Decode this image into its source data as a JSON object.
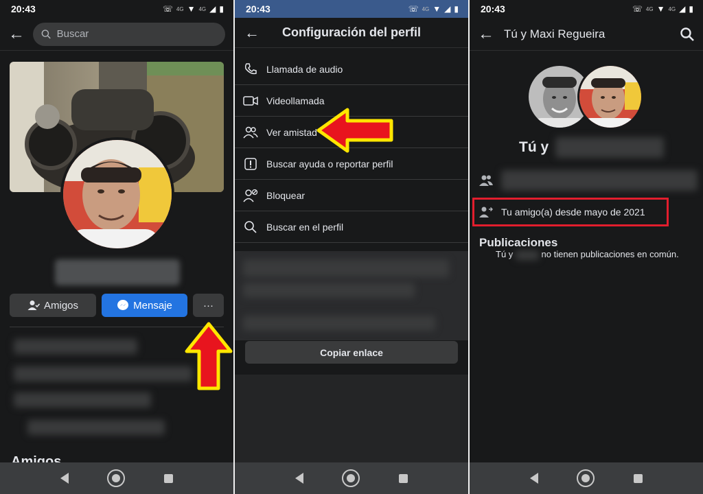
{
  "status": {
    "time": "20:43",
    "network": "4G",
    "network2": "4G"
  },
  "panel1": {
    "search_placeholder": "Buscar",
    "btn_friends": "Amigos",
    "btn_message": "Mensaje",
    "btn_more": "···",
    "section_friends": "Amigos"
  },
  "panel2": {
    "title": "Configuración del perfil",
    "menu": [
      {
        "label": "Llamada de audio",
        "icon": "phone-icon"
      },
      {
        "label": "Videollamada",
        "icon": "video-icon"
      },
      {
        "label": "Ver amistad",
        "icon": "friends-icon"
      },
      {
        "label": "Buscar ayuda o reportar perfil",
        "icon": "report-icon"
      },
      {
        "label": "Bloquear",
        "icon": "block-user-icon"
      },
      {
        "label": "Buscar en el perfil",
        "icon": "search-icon"
      }
    ],
    "copy_link": "Copiar enlace"
  },
  "panel3": {
    "title": "Tú y Maxi Regueira",
    "name_prefix": "Tú y",
    "friends_since": "Tu amigo(a) desde mayo de 2021",
    "publications_heading": "Publicaciones",
    "publications_prefix": "Tú y",
    "publications_suffix": "no tienen publicaciones en común."
  },
  "colors": {
    "bg": "#18191a",
    "accent": "#2374e1",
    "highlight": "#e21e2d",
    "arrow_red": "#e8141e",
    "arrow_yellow": "#ffe600"
  }
}
